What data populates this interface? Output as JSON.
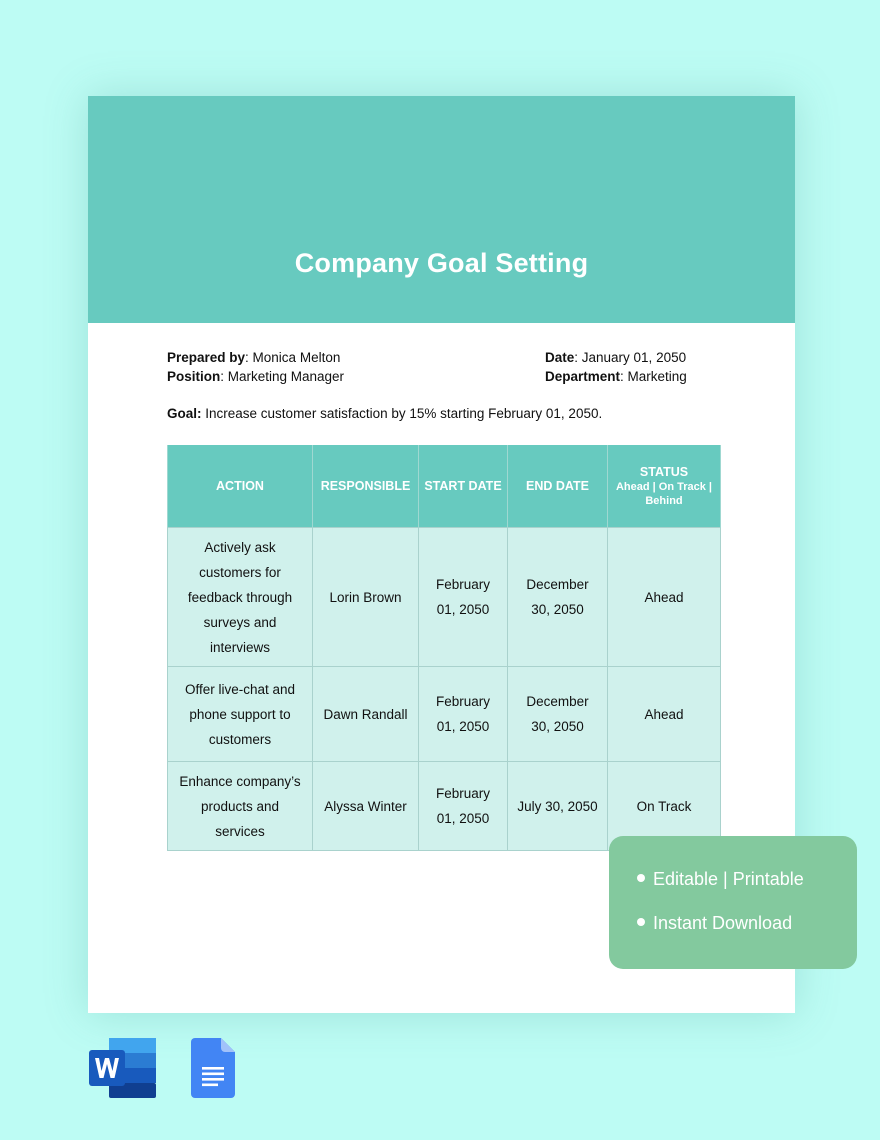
{
  "document": {
    "title": "Company Goal Setting",
    "prepared_by_label": "Prepared by",
    "prepared_by": ": Monica Melton",
    "position_label": "Position",
    "position": ": Marketing Manager",
    "date_label": "Date",
    "date": ": January 01, 2050",
    "department_label": "Department",
    "department": ": Marketing",
    "goal_label": "Goal:",
    "goal": " Increase customer satisfaction by 15% starting February 01, 2050."
  },
  "table": {
    "headers": {
      "action": "ACTION",
      "responsible": "RESPONSIBLE",
      "start_date": "START DATE",
      "end_date": "END DATE",
      "status": "STATUS",
      "status_sub": "Ahead | On Track | Behind"
    },
    "rows": [
      {
        "action": "Actively ask customers for feedback through surveys and interviews",
        "responsible": "Lorin Brown",
        "start_date": "February 01, 2050",
        "end_date": "December 30, 2050",
        "status": "Ahead"
      },
      {
        "action": "Offer live-chat and phone support to customers",
        "responsible": "Dawn Randall",
        "start_date": "February 01, 2050",
        "end_date": "December 30, 2050",
        "status": "Ahead"
      },
      {
        "action": "Enhance company’s products and services",
        "responsible": "Alyssa Winter",
        "start_date": "February 01, 2050",
        "end_date": "July 30, 2050",
        "status": "On Track"
      }
    ]
  },
  "promo": {
    "items": [
      "Editable | Printable",
      "Instant Download"
    ]
  },
  "formats": {
    "icons": [
      "microsoft-word-icon",
      "google-docs-icon"
    ]
  },
  "colors": {
    "background": "#bdfcf4",
    "banner": "#67cabf",
    "table_cell": "#d0f1ec",
    "promo": "#83c99e"
  }
}
